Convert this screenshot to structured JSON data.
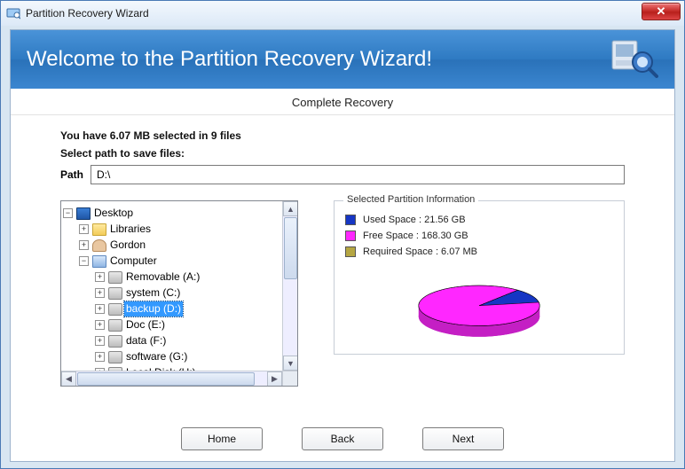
{
  "window": {
    "title": "Partition Recovery Wizard"
  },
  "header": {
    "welcome": "Welcome to the Partition Recovery Wizard!",
    "subtitle": "Complete Recovery"
  },
  "selection": {
    "summary": "You have 6.07 MB selected in 9 files",
    "prompt": "Select path to save files:",
    "path_label": "Path",
    "path_value": "D:\\"
  },
  "tree": {
    "root": {
      "label": "Desktop",
      "expanded": true,
      "icon": "desktop",
      "children": [
        {
          "label": "Libraries",
          "icon": "folder",
          "expanded": false,
          "expandable": true
        },
        {
          "label": "Gordon",
          "icon": "user",
          "expanded": false,
          "expandable": true
        },
        {
          "label": "Computer",
          "icon": "computer",
          "expanded": true,
          "expandable": true,
          "children": [
            {
              "label": "Removable (A:)",
              "icon": "drive",
              "expandable": true
            },
            {
              "label": "system (C:)",
              "icon": "drive",
              "expandable": true
            },
            {
              "label": "backup (D:)",
              "icon": "drive",
              "expandable": true,
              "selected": true
            },
            {
              "label": "Doc (E:)",
              "icon": "drive",
              "expandable": true
            },
            {
              "label": "data (F:)",
              "icon": "drive",
              "expandable": true
            },
            {
              "label": "software (G:)",
              "icon": "drive",
              "expandable": true
            },
            {
              "label": "Local Disk (H:)",
              "icon": "drive",
              "expandable": true
            }
          ]
        }
      ]
    }
  },
  "partition_info": {
    "title": "Selected Partition Information",
    "used_label": "Used Space : 21.56 GB",
    "free_label": "Free Space : 168.30 GB",
    "required_label": "Required Space : 6.07 MB",
    "colors": {
      "used": "#1636c4",
      "free": "#ff27ff",
      "required": "#b5a642"
    }
  },
  "chart_data": {
    "type": "pie",
    "title": "Selected Partition Information",
    "series": [
      {
        "name": "Used Space",
        "value": 21.56,
        "unit": "GB",
        "color": "#1636c4"
      },
      {
        "name": "Free Space",
        "value": 168.3,
        "unit": "GB",
        "color": "#ff27ff"
      },
      {
        "name": "Required Space",
        "value": 0.00607,
        "unit": "GB",
        "color": "#b5a642"
      }
    ]
  },
  "buttons": {
    "home": "Home",
    "back": "Back",
    "next": "Next"
  }
}
